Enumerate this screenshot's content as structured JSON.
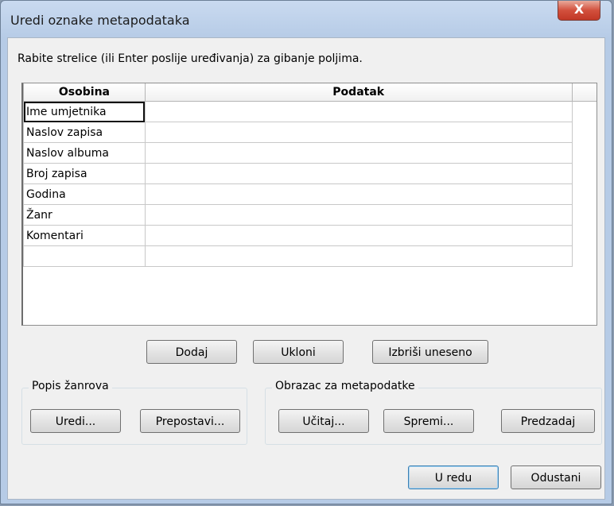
{
  "window": {
    "title": "Uredi oznake metapodataka",
    "close_symbol": "X"
  },
  "hint": "Rabite strelice (ili Enter poslije uređivanja) za gibanje poljima.",
  "grid": {
    "headers": [
      "Osobina",
      "Podatak"
    ],
    "rows": [
      {
        "property": "Ime umjetnika",
        "value": ""
      },
      {
        "property": "Naslov zapisa",
        "value": ""
      },
      {
        "property": "Naslov albuma",
        "value": ""
      },
      {
        "property": "Broj zapisa",
        "value": ""
      },
      {
        "property": "Godina",
        "value": ""
      },
      {
        "property": "Žanr",
        "value": ""
      },
      {
        "property": "Komentari",
        "value": ""
      },
      {
        "property": "",
        "value": ""
      }
    ]
  },
  "buttons": {
    "add": "Dodaj",
    "remove": "Ukloni",
    "clear": "Izbriši uneseno",
    "ok": "U redu",
    "cancel": "Odustani"
  },
  "genre_group": {
    "label": "Popis žanrova",
    "edit": "Uredi...",
    "reset": "Prepostavi..."
  },
  "template_group": {
    "label": "Obrazac za metapodatke",
    "load": "Učitaj...",
    "save": "Spremi...",
    "default": "Predzadaj"
  }
}
